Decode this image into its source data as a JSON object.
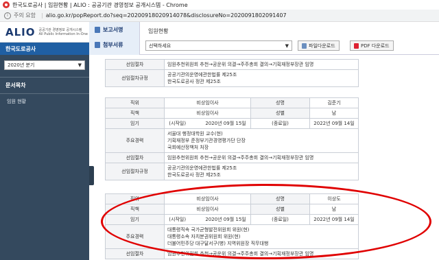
{
  "window": {
    "title": "한국도로공사 | 임원현황 | ALIO : 공공기관 경영정보 공개시스템 - Chrome"
  },
  "address": {
    "warning": "주의 요함",
    "url": "alio.go.kr/popReport.do?seq=20200918020914078&disclosureNo=2020091802091407"
  },
  "sidebar": {
    "logo": "ALIO",
    "logo_sub1": "공공기관 경영정보 공개시스템",
    "logo_sub2": "All Public Information In-One",
    "org": "한국도로공사",
    "period": "2020년 분기",
    "menu_title": "문서목차",
    "items": [
      "임원 현황"
    ]
  },
  "toolbar": {
    "tab_report": "보고서명",
    "tab_attach": "첨부서류",
    "report_name": "임원현황",
    "select_placeholder": "선택하세요",
    "file_download": "파일다운로드",
    "pdf_download": "PDF 다운로드"
  },
  "section1": {
    "rows": [
      {
        "k": "선임절차",
        "v": "임원추천위원회 추천→공운위 의결→주주총회 결의→기획재정부장관 임명"
      },
      {
        "k": "선임절차규정",
        "v1": "공공기관의운영에관한법률 제25조",
        "v2": "한국도로공사 정관 제25조"
      }
    ]
  },
  "section2": {
    "labels": {
      "position": "직위",
      "name_label": "성명",
      "duty": "직책",
      "gender_label": "성별",
      "term": "임기",
      "start": "(시작일)",
      "end": "(종료일)",
      "career": "주요경력",
      "proc": "선임절차",
      "proc_rule": "선임절차규정"
    },
    "position": "비상임이사",
    "name": "김준기",
    "duty": "비상임이사",
    "gender": "남",
    "start_date": "2020년 09월 15일",
    "end_date": "2022년 09월 14일",
    "career": [
      "서울대 행정대학원 교수(현)",
      "기획재정부 준정부기관경영평가단 단장",
      "국회예산정책처 처장"
    ],
    "proc": "임원추천위원회 추천→공운위 의결→주주총회 결의→기획재정부장관 임명",
    "rule1": "공공기관의운영에관한법률 제25조",
    "rule2": "한국도로공사 정관 제25조"
  },
  "section3": {
    "labels": {
      "position": "직위",
      "name_label": "성명",
      "duty": "직책",
      "gender_label": "성별",
      "term": "임기",
      "start": "(시작일)",
      "end": "(종료일)",
      "career": "주요경력",
      "proc": "선임절차"
    },
    "position": "비상임이사",
    "name": "이상도",
    "duty": "비상임이사",
    "gender": "남",
    "start_date": "2020년 09월 15일",
    "end_date": "2022년 09월 14일",
    "career": [
      "대통령직속 국가균형발전위원회 위원(현)",
      "대통령소속 자치분권위원회 위원(현)",
      "더불어민주당 대구달서구(병) 지역위원장 직무대행"
    ],
    "proc": "임원추천위원회 추천→공운위 의결→주주총회 결의→기획재정부장관 임명"
  },
  "colors": {
    "sidebar": "#34495e",
    "org_bar": "#1f5fa3",
    "highlight_ring": "#e00000"
  }
}
